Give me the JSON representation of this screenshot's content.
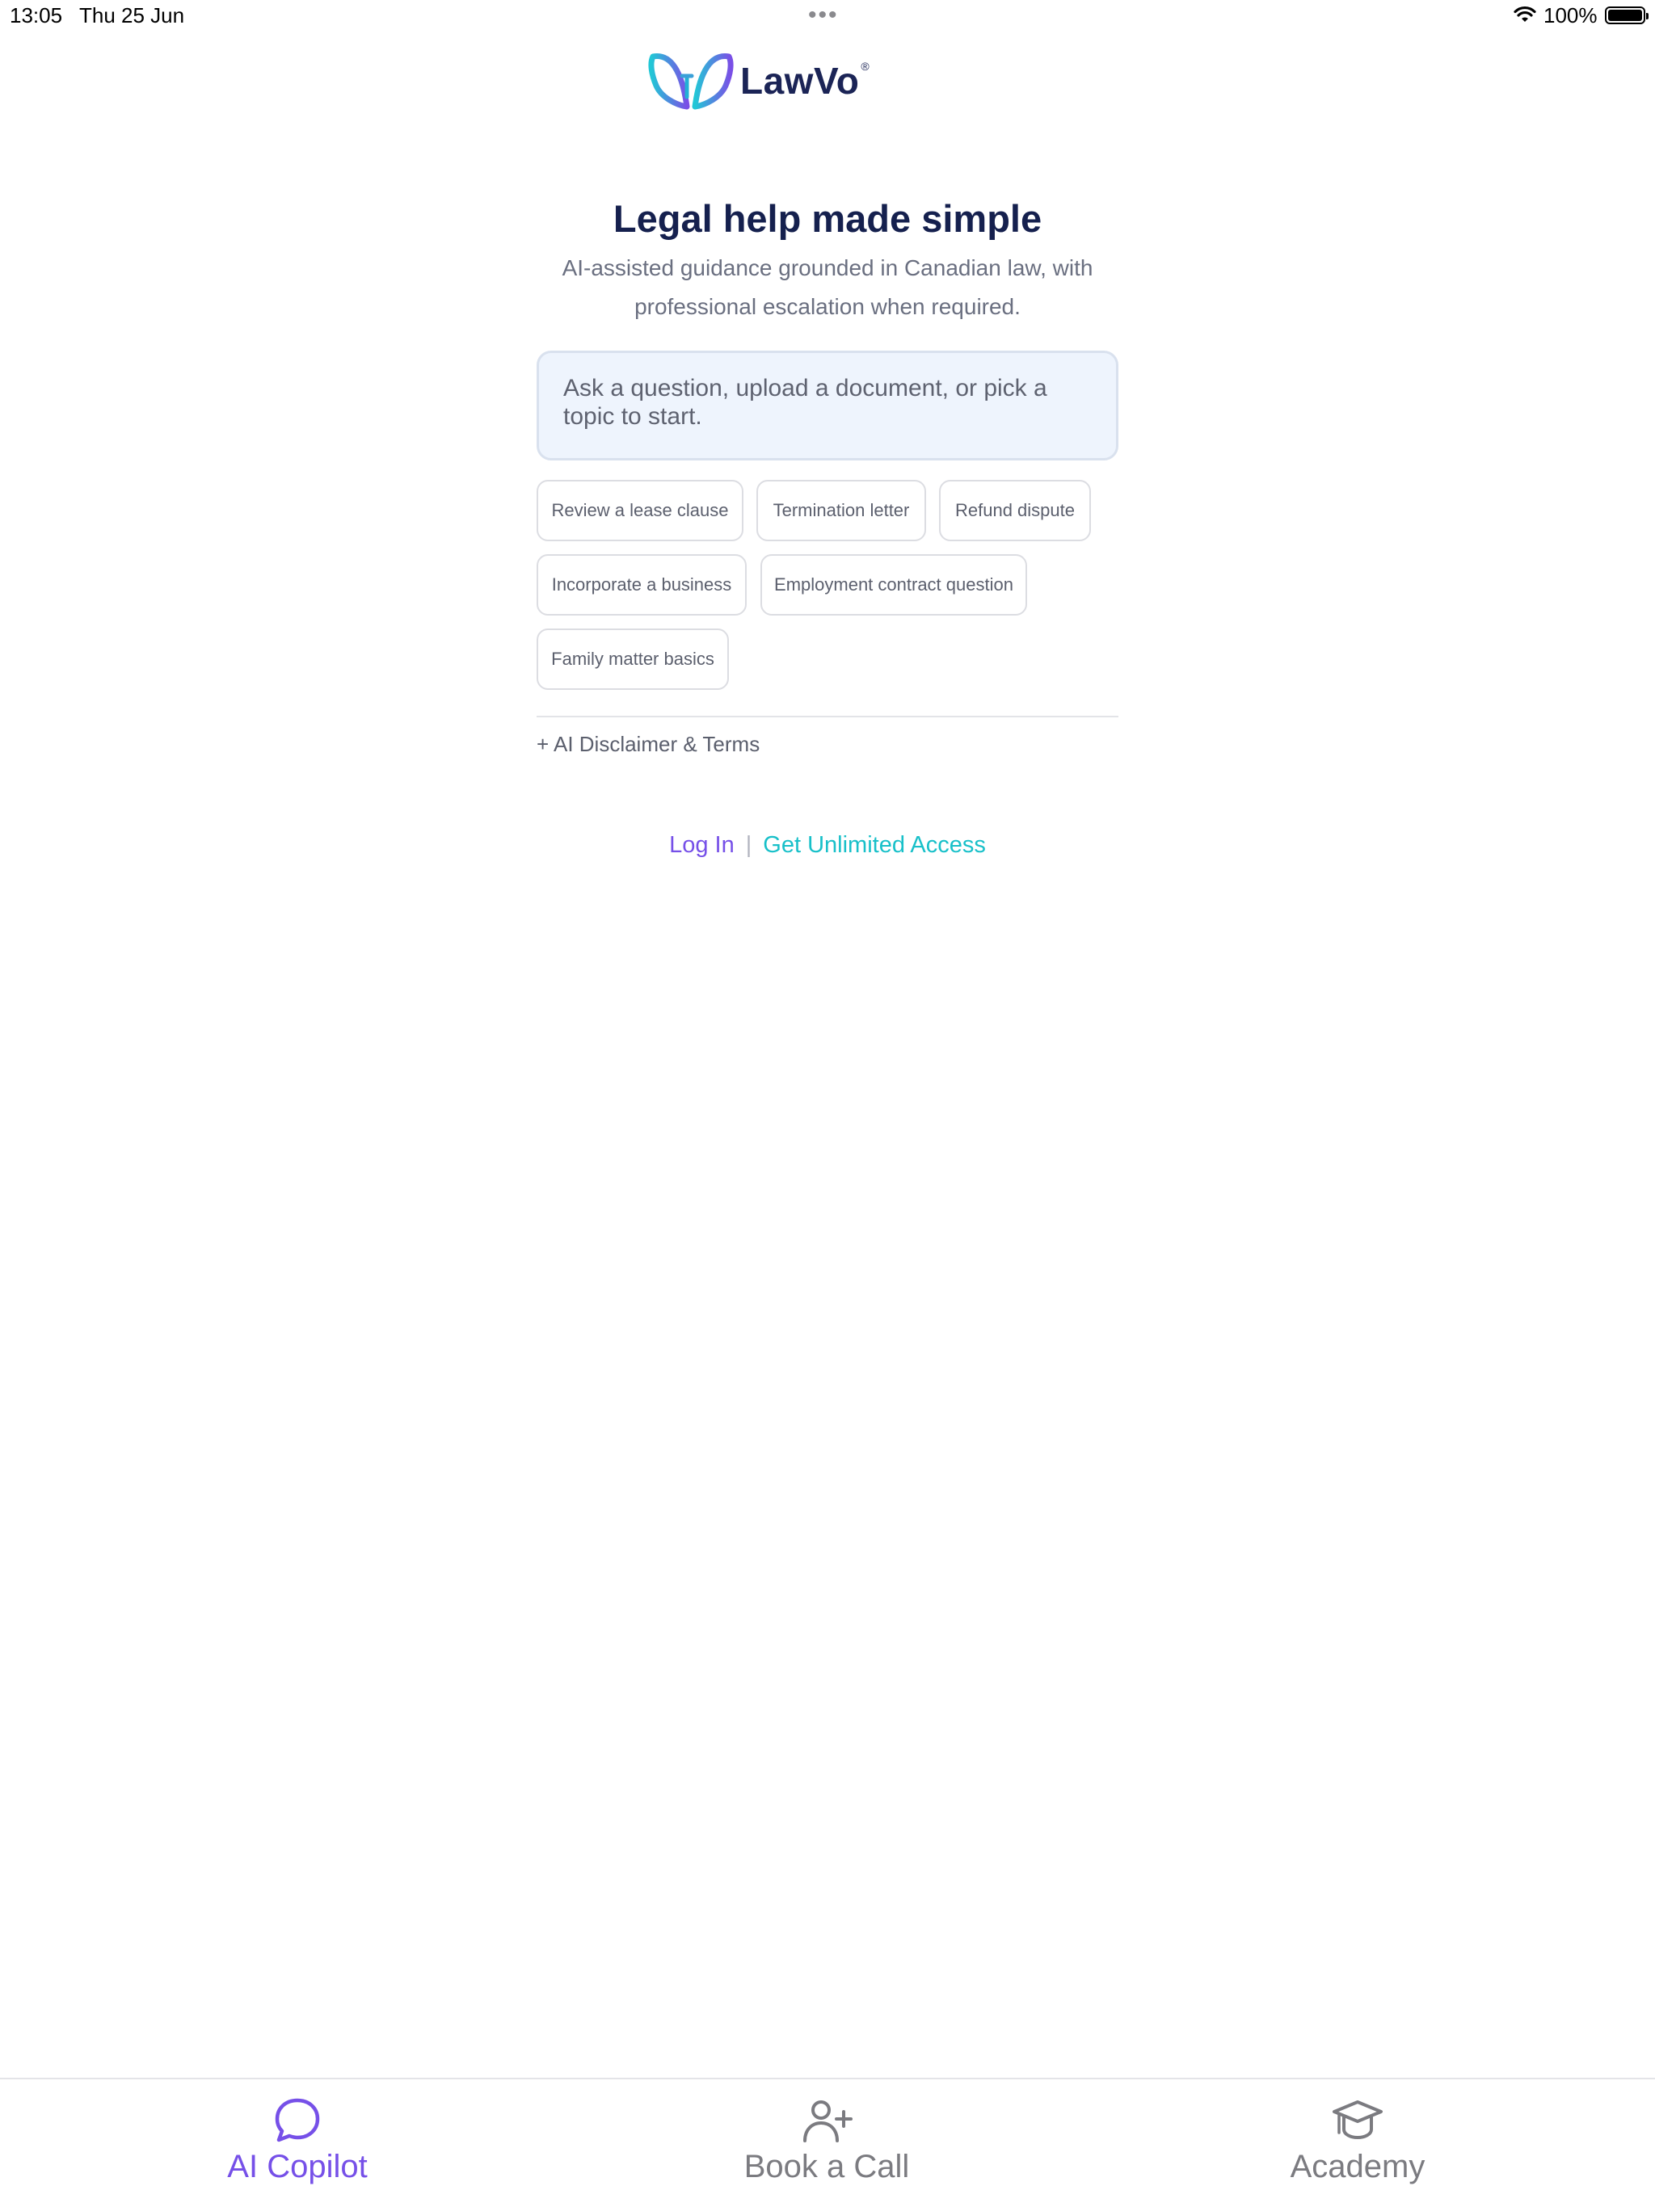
{
  "status_bar": {
    "time": "13:05",
    "date": "Thu 25 Jun",
    "battery": "100%"
  },
  "brand": {
    "name": "LawVo",
    "registered": "®",
    "colors": {
      "primary": "#7650e8",
      "accent": "#18c0c9",
      "navy": "#15204e"
    }
  },
  "hero": {
    "title": "Legal help made simple",
    "subtitle": "AI-assisted guidance grounded in Canadian law, with professional escalation when required."
  },
  "prompt": {
    "placeholder": "Ask a question, upload a document, or pick a topic to start."
  },
  "suggestions": [
    "Review a lease clause",
    "Termination letter",
    "Refund dispute",
    "Incorporate a business",
    "Employment contract question",
    "Family matter basics"
  ],
  "disclaimer": "+ AI Disclaimer & Terms",
  "auth": {
    "login": "Log In",
    "separator": "|",
    "unlimited": "Get Unlimited Access"
  },
  "tabs": [
    {
      "label": "AI Copilot",
      "icon": "chat-bubble-icon",
      "active": true
    },
    {
      "label": "Book a Call",
      "icon": "add-person-icon",
      "active": false
    },
    {
      "label": "Academy",
      "icon": "graduation-cap-icon",
      "active": false
    }
  ]
}
